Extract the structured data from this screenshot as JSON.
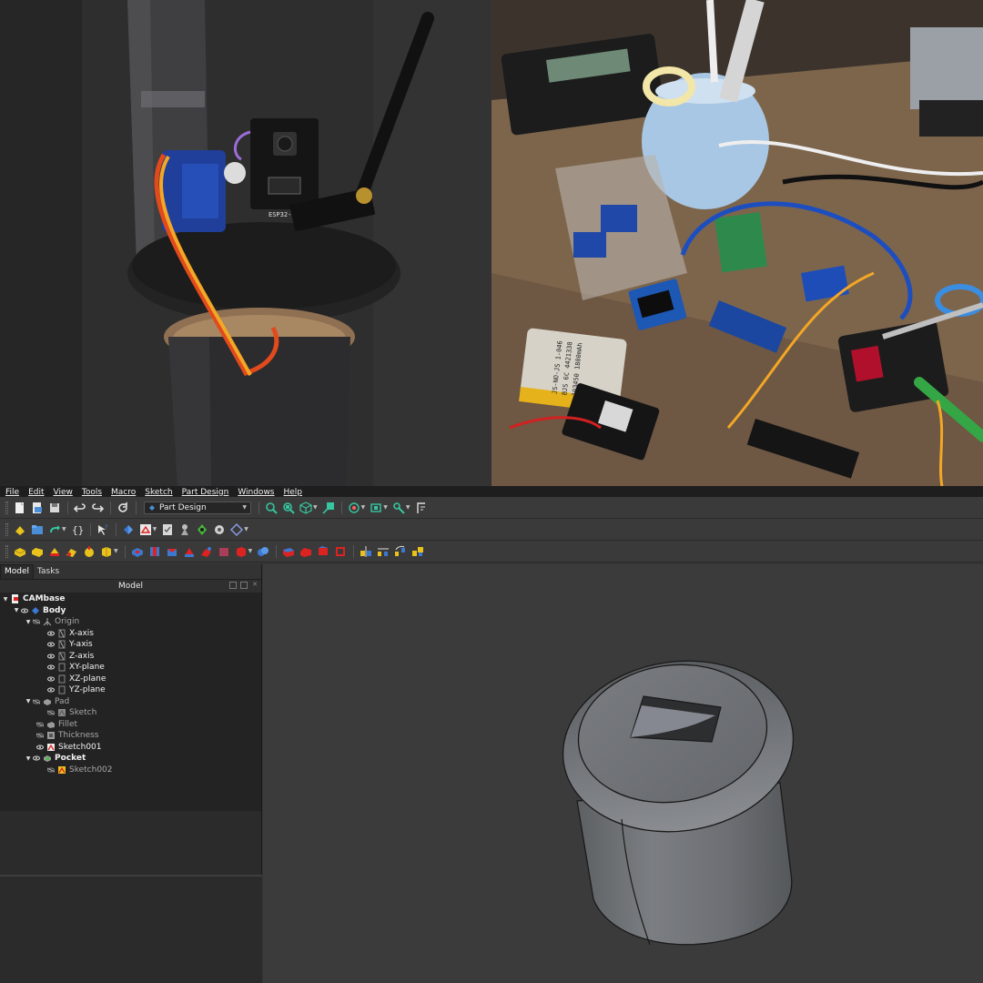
{
  "photos": {
    "left": {
      "board_label": "ESP32-CAM"
    },
    "right": {
      "battery_label_lines": [
        "JS-NO-JS 1-046",
        "BJS 6C 4421338",
        "103450 1800mAh"
      ]
    }
  },
  "menubar": {
    "items": [
      "File",
      "Edit",
      "View",
      "Tools",
      "Macro",
      "Sketch",
      "Part Design",
      "Windows",
      "Help"
    ]
  },
  "toolbar": {
    "workbench": "Part Design"
  },
  "combo": {
    "tabs": [
      "Model",
      "Tasks"
    ],
    "panel_title": "Model"
  },
  "tree": {
    "items": [
      {
        "label": "CAMbase",
        "icon": "document-icon"
      },
      {
        "label": "Body",
        "icon": "body-icon"
      },
      {
        "label": "Origin",
        "icon": "origin-icon"
      },
      {
        "label": "X-axis",
        "icon": "axis-icon"
      },
      {
        "label": "Y-axis",
        "icon": "axis-icon"
      },
      {
        "label": "Z-axis",
        "icon": "axis-icon"
      },
      {
        "label": "XY-plane",
        "icon": "plane-icon"
      },
      {
        "label": "XZ-plane",
        "icon": "plane-icon"
      },
      {
        "label": "YZ-plane",
        "icon": "plane-icon"
      },
      {
        "label": "Pad",
        "icon": "pad-icon"
      },
      {
        "label": "Sketch",
        "icon": "sketch-icon"
      },
      {
        "label": "Fillet",
        "icon": "fillet-icon"
      },
      {
        "label": "Thickness",
        "icon": "thickness-icon"
      },
      {
        "label": "Sketch001",
        "icon": "sketch-icon"
      },
      {
        "label": "Pocket",
        "icon": "pocket-icon"
      },
      {
        "label": "Sketch002",
        "icon": "sketch-icon"
      }
    ]
  },
  "colors": {
    "menubar_bg": "#1e1e1e",
    "panel_bg": "#2b2b2b",
    "view_bg": "#3b3b3b",
    "model_gray": "#6e7174"
  }
}
